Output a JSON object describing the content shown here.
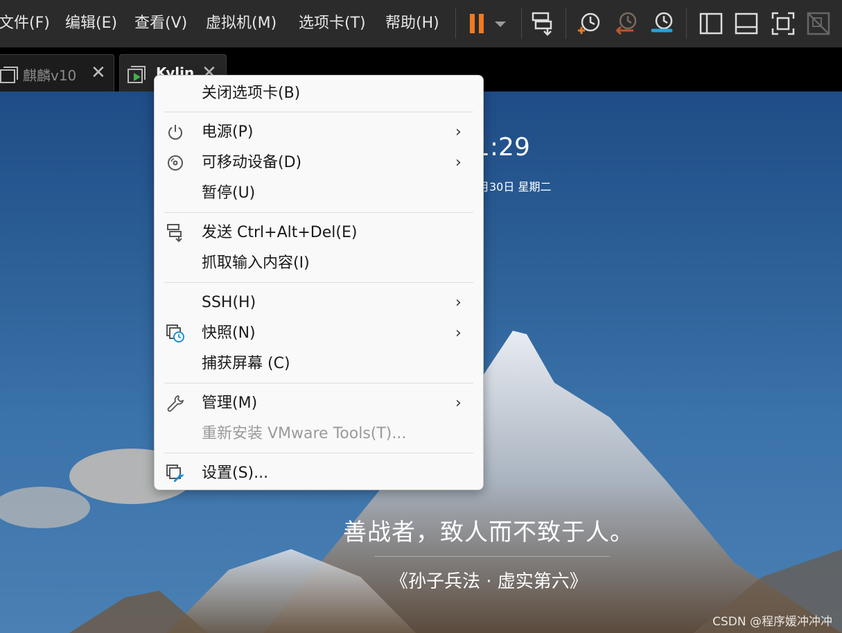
{
  "menubar": {
    "items": [
      "文件(F)",
      "编辑(E)",
      "查看(V)",
      "虚拟机(M)",
      "选项卡(T)",
      "帮助(H)"
    ]
  },
  "toolbar": {
    "icons": [
      "pause-icon",
      "dropdown-arrow-icon",
      "send-ctrl-alt-del-icon",
      "take-snapshot-icon",
      "revert-snapshot-icon",
      "snapshot-manager-icon",
      "sidebar-icon",
      "console-view-icon",
      "fullscreen-icon",
      "unity-icon"
    ],
    "accent": "#f07a20"
  },
  "tabs": [
    {
      "label": "麒麟v10",
      "close": "✕"
    },
    {
      "label": "Kylin",
      "close": "✕"
    }
  ],
  "desktop": {
    "clock": "1:29",
    "date": "月30日 星期二",
    "quote": "善战者，致人而不致于人。",
    "source": "《孙子兵法 · 虚实第六》",
    "watermark": "CSDN @程序媛冲冲冲"
  },
  "context_menu": {
    "items": [
      {
        "label": "关闭选项卡(B)",
        "icon": "",
        "submenu": false,
        "disabled": false
      },
      {
        "label": "电源(P)",
        "icon": "power-icon",
        "submenu": true,
        "disabled": false
      },
      {
        "label": "可移动设备(D)",
        "icon": "disc-icon",
        "submenu": true,
        "disabled": false
      },
      {
        "label": "暂停(U)",
        "icon": "",
        "submenu": false,
        "disabled": false
      },
      {
        "label": "发送 Ctrl+Alt+Del(E)",
        "icon": "send-keys-icon",
        "submenu": false,
        "disabled": false
      },
      {
        "label": "抓取输入内容(I)",
        "icon": "",
        "submenu": false,
        "disabled": false
      },
      {
        "label": "SSH(H)",
        "icon": "",
        "submenu": true,
        "disabled": false
      },
      {
        "label": "快照(N)",
        "icon": "snapshot-icon",
        "submenu": true,
        "disabled": false
      },
      {
        "label": "捕获屏幕 (C)",
        "icon": "",
        "submenu": false,
        "disabled": false
      },
      {
        "label": "管理(M)",
        "icon": "wrench-icon",
        "submenu": true,
        "disabled": false
      },
      {
        "label": "重新安装 VMware Tools(T)...",
        "icon": "",
        "submenu": false,
        "disabled": true
      },
      {
        "label": "设置(S)...",
        "icon": "settings-icon",
        "submenu": false,
        "disabled": false
      }
    ],
    "submenu_arrow": "›"
  }
}
